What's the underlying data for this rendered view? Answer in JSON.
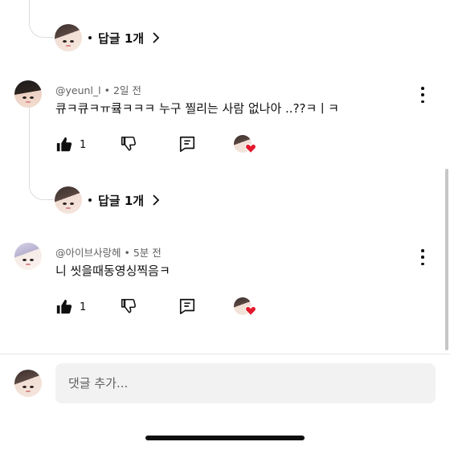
{
  "top_reply_toggle": {
    "dot": "•",
    "label": "답글 1개",
    "icon": "chevron-right-icon"
  },
  "comments": [
    {
      "author": "@yeunl_l",
      "time": "2일 전",
      "separator": "•",
      "text": "큐ㅋ큐ㅋㅠ큨ㅋㅋㅋ 누구 찔리는 사람 없나아 ..??ㅋㅣㅋ",
      "likes": "1",
      "reply_toggle": {
        "dot": "•",
        "label": "답글 1개"
      }
    },
    {
      "author": "@아이브사랑헤",
      "time": "5분 전",
      "separator": "•",
      "text": "니 씻을때동영싱찍음ㅋ",
      "likes": "1"
    }
  ],
  "add_comment": {
    "placeholder": "댓글 추가..."
  },
  "colors": {
    "heart": "#e4182b",
    "text": "#0f0f0f",
    "meta": "#606060",
    "input_bg": "#f2f2f2"
  }
}
